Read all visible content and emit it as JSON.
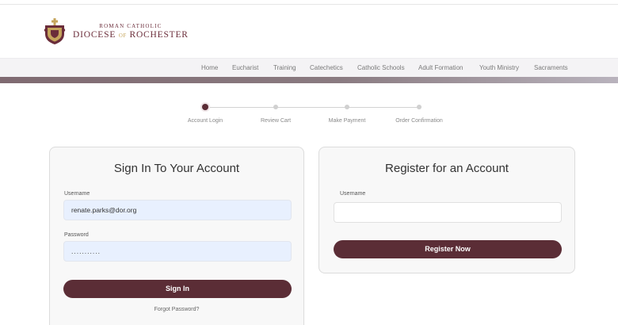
{
  "brand": {
    "line1": "ROMAN CATHOLIC",
    "line2_a": "DIOCESE",
    "line2_of": "OF",
    "line2_b": "ROCHESTER"
  },
  "nav": {
    "items": [
      "Home",
      "Eucharist",
      "Training",
      "Catechetics",
      "Catholic Schools",
      "Adult Formation",
      "Youth Ministry",
      "Sacraments"
    ]
  },
  "steps": {
    "items": [
      "Account Login",
      "Review Cart",
      "Make Payment",
      "Order Confirmation"
    ],
    "active_index": 0
  },
  "signin": {
    "title": "Sign In To Your Account",
    "username_label": "Username",
    "username_value": "renate.parks@dor.org",
    "password_label": "Password",
    "password_value": "...........",
    "button": "Sign In",
    "forgot": "Forgot Password?"
  },
  "register": {
    "title": "Register for an Account",
    "username_label": "Username",
    "username_value": "",
    "button": "Register Now"
  },
  "colors": {
    "brand": "#5b2d36",
    "gold": "#c6a55c",
    "autofill": "#e8f0fe"
  },
  "icons": {
    "logo": "diocese-crest-icon"
  }
}
